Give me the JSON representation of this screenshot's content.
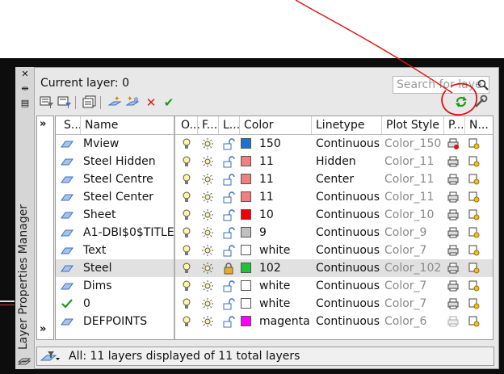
{
  "palette": {
    "title": "Layer Properties Manager",
    "current_layer": "Current layer: 0",
    "search_placeholder": "Search for laye"
  },
  "columns": [
    "S...",
    "Name",
    "O...",
    "F...",
    "L...",
    "Color",
    "Linetype",
    "Plot Style",
    "P...",
    "N..."
  ],
  "layers": [
    {
      "name": "Mview",
      "color": "150",
      "swatch": "#1e6fd9",
      "linetype": "Continuous",
      "plot_style": "Color_150",
      "status": "layer",
      "plot": "no-plot",
      "lock": "unlocked"
    },
    {
      "name": "Steel Hidden",
      "color": "11",
      "swatch": "#f08080",
      "linetype": "Hidden",
      "plot_style": "Color_11",
      "status": "layer",
      "plot": "plot",
      "lock": "unlocked"
    },
    {
      "name": "Steel Centre",
      "color": "11",
      "swatch": "#f08080",
      "linetype": "Center",
      "plot_style": "Color_11",
      "status": "layer",
      "plot": "plot",
      "lock": "unlocked"
    },
    {
      "name": "Steel Center",
      "color": "11",
      "swatch": "#f08080",
      "linetype": "Continuous",
      "plot_style": "Color_11",
      "status": "layer",
      "plot": "plot",
      "lock": "unlocked"
    },
    {
      "name": "Sheet",
      "color": "10",
      "swatch": "#ee0000",
      "linetype": "Continuous",
      "plot_style": "Color_10",
      "status": "layer",
      "plot": "plot",
      "lock": "unlocked"
    },
    {
      "name": "A1-DBI$0$TITLE",
      "color": "9",
      "swatch": "#c0c0c0",
      "linetype": "Continuous",
      "plot_style": "Color_9",
      "status": "layer",
      "plot": "plot",
      "lock": "unlocked"
    },
    {
      "name": "Text",
      "color": "white",
      "swatch": "#ffffff",
      "linetype": "Continuous",
      "plot_style": "Color_7",
      "status": "layer",
      "plot": "plot",
      "lock": "unlocked"
    },
    {
      "name": "Steel",
      "color": "102",
      "swatch": "#1ec23a",
      "linetype": "Continuous",
      "plot_style": "Color_102",
      "status": "layer",
      "plot": "plot",
      "lock": "locked",
      "selected": true
    },
    {
      "name": "Dims",
      "color": "white",
      "swatch": "#ffffff",
      "linetype": "Continuous",
      "plot_style": "Color_7",
      "status": "layer",
      "plot": "plot",
      "lock": "unlocked"
    },
    {
      "name": "0",
      "color": "white",
      "swatch": "#ffffff",
      "linetype": "Continuous",
      "plot_style": "Color_7",
      "status": "current",
      "plot": "plot",
      "lock": "unlocked"
    },
    {
      "name": "DEFPOINTS",
      "color": "magenta",
      "swatch": "#ff00ff",
      "linetype": "Continuous",
      "plot_style": "Color_6",
      "status": "layer",
      "plot": "plot-disabled",
      "lock": "unlocked"
    }
  ],
  "status_bar": {
    "text": "All: 11 layers displayed of 11 total layers"
  },
  "toolbar_icons": [
    "new-property-filter-icon",
    "new-group-filter-icon",
    "layer-states-manager-icon",
    "new-layer-icon",
    "new-layer-vp-frozen-icon",
    "delete-layer-icon",
    "set-current-icon"
  ],
  "annotation_color": "#e01010"
}
